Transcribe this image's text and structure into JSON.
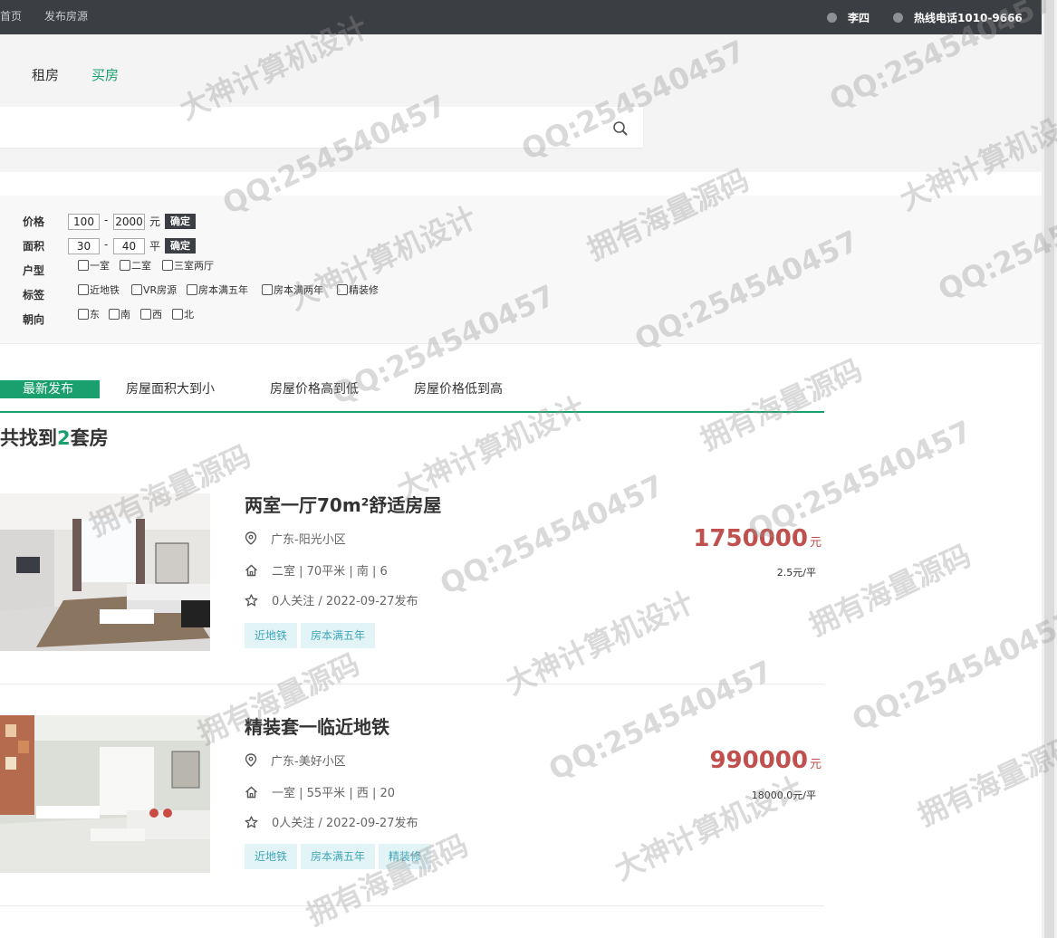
{
  "topbar": {
    "nav": [
      "首页",
      "发布房源"
    ],
    "user_name": "李四",
    "hotline": "热线电话1010-9666"
  },
  "mode_tabs": [
    {
      "label": "租房",
      "active": false
    },
    {
      "label": "买房",
      "active": true
    }
  ],
  "search": {
    "placeholder": "",
    "value": ""
  },
  "filters": {
    "price": {
      "label": "价格",
      "min": "100",
      "max": "2000",
      "unit": "元",
      "confirm": "确定"
    },
    "area": {
      "label": "面积",
      "min": "30",
      "max": "40",
      "unit": "平",
      "confirm": "确定"
    },
    "layout": {
      "label": "户型",
      "options": [
        "一室",
        "二室",
        "三室两厅"
      ]
    },
    "tags": {
      "label": "标签",
      "options": [
        "近地铁",
        "VR房源",
        "房本满五年",
        "房本满两年",
        "精装修"
      ]
    },
    "orientation": {
      "label": "朝向",
      "options": [
        "东",
        "南",
        "西",
        "北"
      ]
    },
    "range_separator": "-"
  },
  "sort_tabs": [
    "最新发布",
    "房屋面积大到小",
    "房屋价格高到低",
    "房屋价格低到高"
  ],
  "result": {
    "prefix": "共找到",
    "count": "2",
    "suffix": "套房"
  },
  "listings": [
    {
      "title": "两室一厅70m²舒适房屋",
      "location": "广东-阳光小区",
      "details": "二室 | 70平米 | 南 | 6",
      "meta": "0人关注 / 2022-09-27发布",
      "tags": [
        "近地铁",
        "房本满五年"
      ],
      "price": "1750000",
      "currency": "元",
      "unit_price": "2.5元/平"
    },
    {
      "title": "精装套一临近地铁",
      "location": "广东-美好小区",
      "details": "一室 | 55平米 | 西 | 20",
      "meta": "0人关注 / 2022-09-27发布",
      "tags": [
        "近地铁",
        "房本满五年",
        "精装修"
      ],
      "price": "990000",
      "currency": "元",
      "unit_price": "18000.0元/平"
    }
  ],
  "watermark": {
    "qq": "QQ:254540457",
    "design": "大神计算机设计",
    "source": "拥有海量源码"
  },
  "colors": {
    "accent": "#1aa06e",
    "price": "#c0504d",
    "topbar": "#3b3e42",
    "tag_bg": "#e3f4f7",
    "tag_text": "#41a6b8"
  },
  "icons": [
    "user-icon",
    "phone-icon",
    "search-icon",
    "location-pin-icon",
    "house-icon",
    "star-icon"
  ]
}
